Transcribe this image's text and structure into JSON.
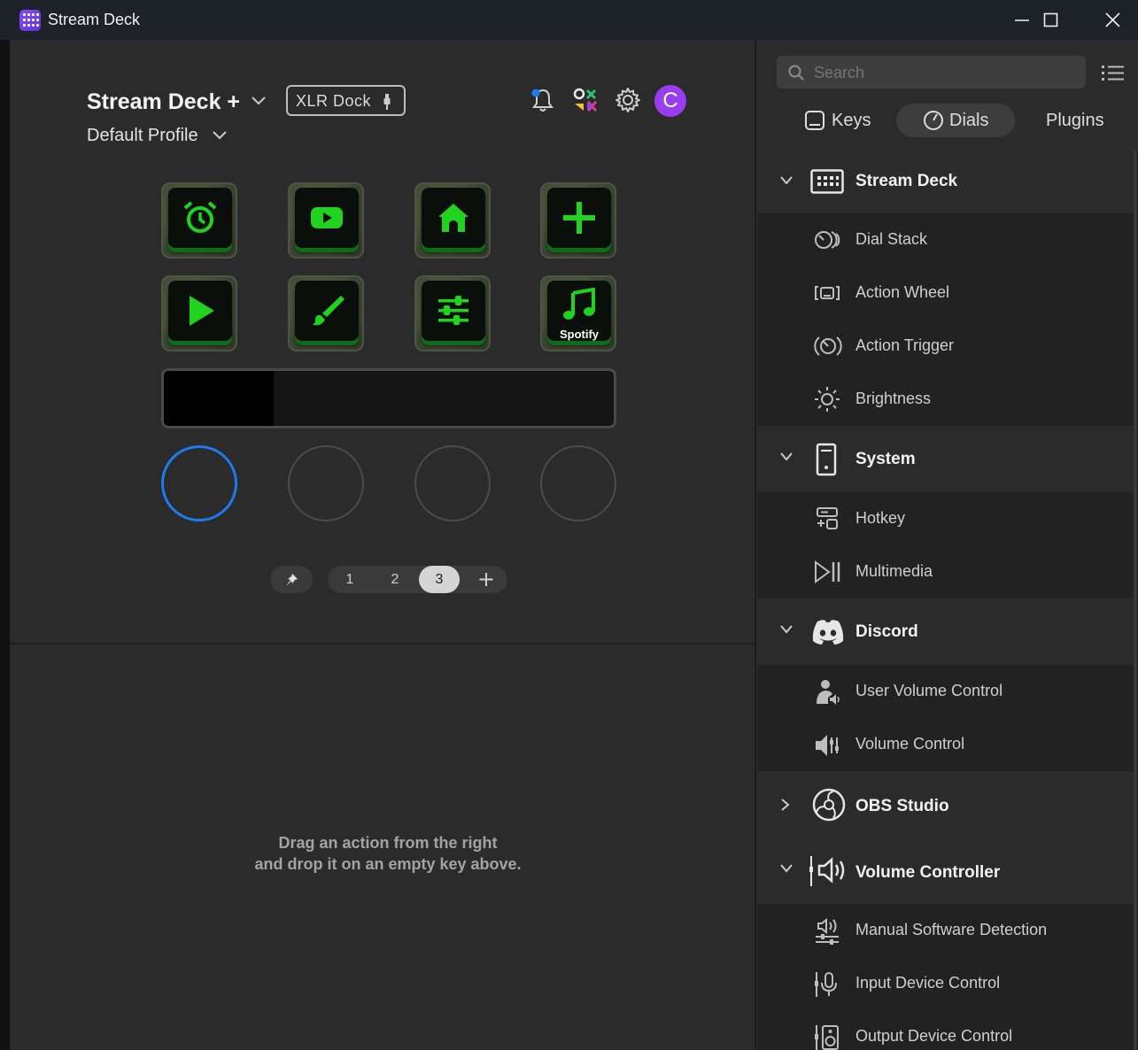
{
  "window": {
    "title": "Stream Deck"
  },
  "device": {
    "name": "Stream Deck +",
    "profile": "Default Profile",
    "dock_badge": "XLR Dock"
  },
  "avatar": {
    "initial": "C",
    "color": "#9a3cf0"
  },
  "keys": [
    {
      "icon": "alarm-clock-icon",
      "label": ""
    },
    {
      "icon": "youtube-icon",
      "label": ""
    },
    {
      "icon": "home-icon",
      "label": ""
    },
    {
      "icon": "plus-icon",
      "label": ""
    },
    {
      "icon": "play-icon",
      "label": ""
    },
    {
      "icon": "paint-brush-icon",
      "label": ""
    },
    {
      "icon": "sliders-icon",
      "label": ""
    },
    {
      "icon": "music-note-icon",
      "label": "Spotify"
    }
  ],
  "pager": {
    "pages": [
      "1",
      "2",
      "3"
    ],
    "active": "3"
  },
  "hint": {
    "line1": "Drag an action from the right",
    "line2": "and drop it on an empty key above."
  },
  "search": {
    "placeholder": "Search"
  },
  "tabs": {
    "keys": "Keys",
    "dials": "Dials",
    "plugins": "Plugins",
    "active": "Dials"
  },
  "categories": {
    "stream_deck": {
      "label": "Stream Deck",
      "items": [
        "Dial Stack",
        "Action Wheel",
        "Action Trigger",
        "Brightness"
      ]
    },
    "system": {
      "label": "System",
      "items": [
        "Hotkey",
        "Multimedia"
      ]
    },
    "discord": {
      "label": "Discord",
      "items": [
        "User Volume Control",
        "Volume Control"
      ]
    },
    "obs": {
      "label": "OBS Studio",
      "items": []
    },
    "volume_controller": {
      "label": "Volume Controller",
      "items": [
        "Manual Software Detection",
        "Input Device Control",
        "Output Device Control"
      ]
    }
  },
  "colors": {
    "accent_green": "#1fd31f",
    "dial_selected": "#1b7bf0",
    "background": "#2b2b2b"
  }
}
